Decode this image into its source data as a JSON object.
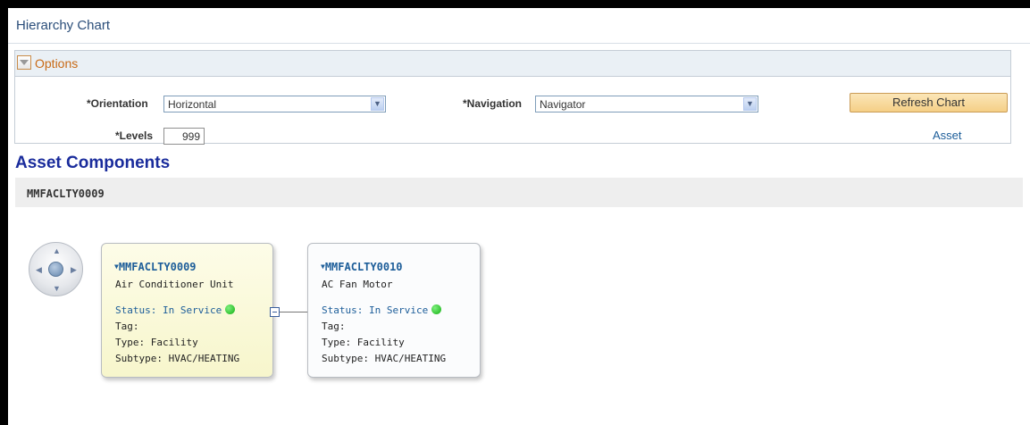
{
  "page": {
    "title": "Hierarchy Chart"
  },
  "options": {
    "section_label": "Options",
    "orientation": {
      "label": "*Orientation",
      "value": "Horizontal"
    },
    "navigation": {
      "label": "*Navigation",
      "value": "Navigator"
    },
    "levels": {
      "label": "*Levels",
      "value": "999"
    },
    "refresh_label": "Refresh Chart",
    "asset_link": "Asset"
  },
  "components": {
    "title": "Asset Components",
    "root_label": "MMFACLTY0009"
  },
  "nodes": [
    {
      "id": "MMFACLTY0009",
      "description": "Air Conditioner Unit",
      "status": "Status: In Service",
      "tag": "Tag:",
      "type": "Type: Facility",
      "subtype": "Subtype: HVAC/HEATING"
    },
    {
      "id": "MMFACLTY0010",
      "description": "AC Fan Motor",
      "status": "Status: In Service",
      "tag": "Tag:",
      "type": "Type: Facility",
      "subtype": "Subtype: HVAC/HEATING"
    }
  ],
  "icons": {
    "toggle": "collapse-triangle-icon",
    "select_arrow": "chevron-down-icon",
    "navigator": "pan-navigator-icon",
    "status_dot": "status-green-icon",
    "collapse": "minus-box-icon"
  },
  "colors": {
    "status_in_service": "#12b012",
    "link": "#1c5d99",
    "section_title": "#1a2c9c",
    "options_label": "#c86a16"
  }
}
